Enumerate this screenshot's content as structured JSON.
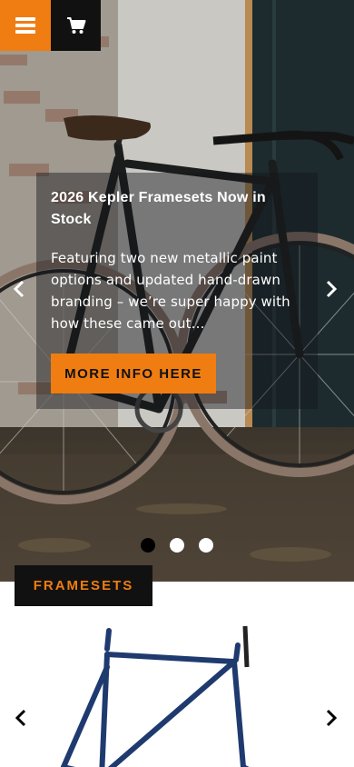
{
  "nav": {
    "menu_icon": "hamburger-icon",
    "cart_icon": "cart-icon"
  },
  "hero": {
    "title": "2026 Kepler Framesets Now in Stock",
    "description": "Featuring two new metallic paint options and updated hand-drawn branding – we’re super happy with how these came out…",
    "cta_label": "MORE INFO HERE",
    "prev_icon": "chevron-left-icon",
    "next_icon": "chevron-right-icon",
    "slide_count": 3,
    "active_slide": 1
  },
  "products": {
    "section_label": "FRAMESETS",
    "prev_icon": "chevron-left-icon",
    "next_icon": "chevron-right-icon"
  },
  "colors": {
    "accent": "#f07d12",
    "dark": "#111111",
    "frame": "#1f3a6e"
  }
}
